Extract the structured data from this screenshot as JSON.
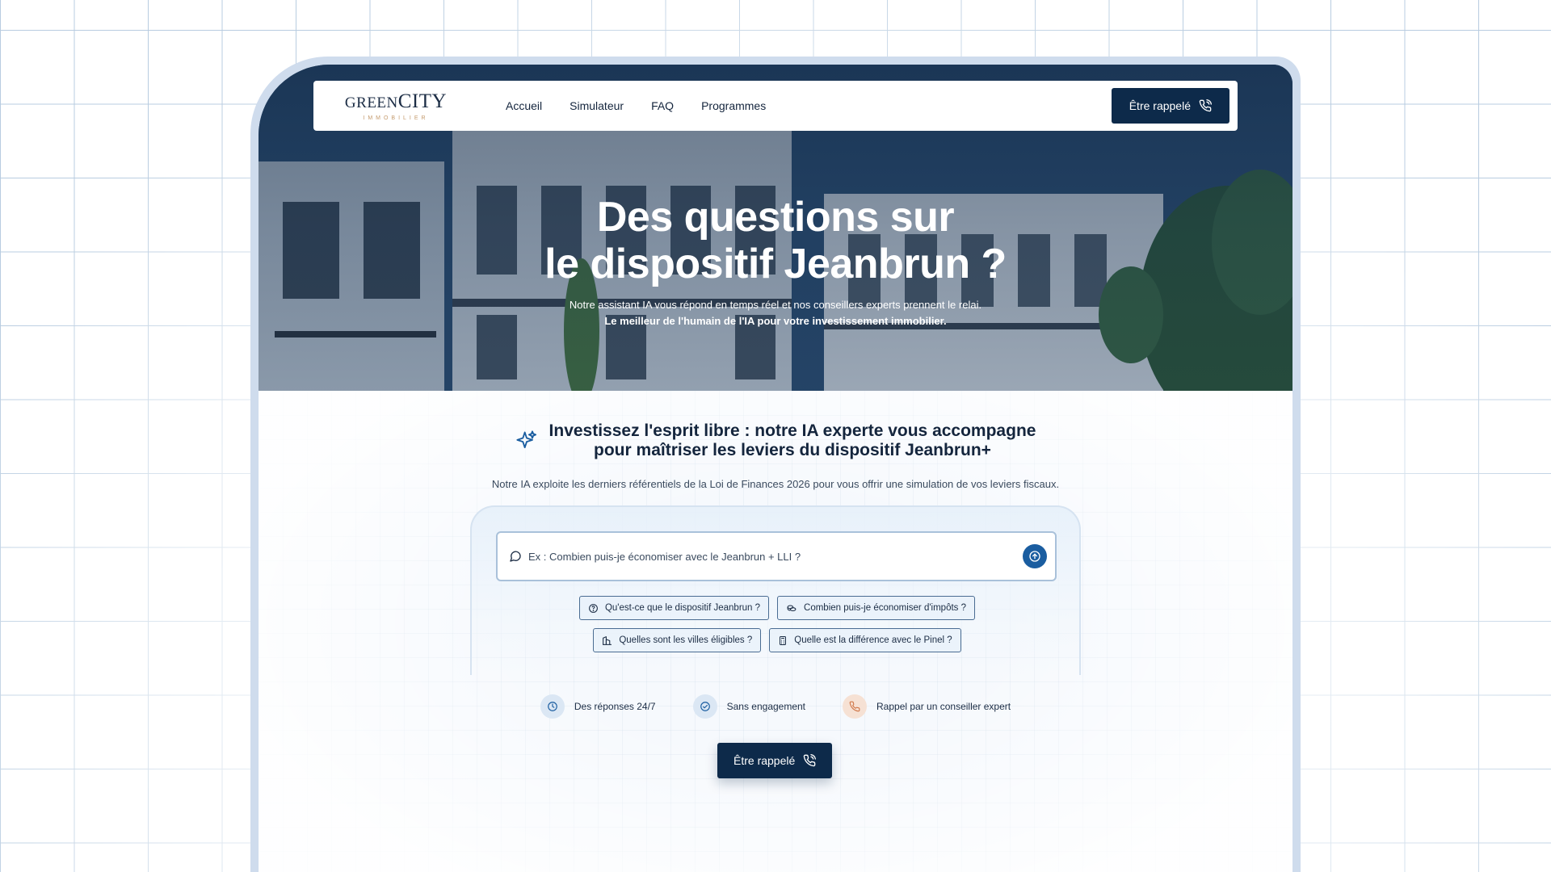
{
  "brand": {
    "name_green": "GREEN",
    "name_city": "CITY",
    "tagline": "IMMOBILIER"
  },
  "nav": {
    "links": [
      "Accueil",
      "Simulateur",
      "FAQ",
      "Programmes"
    ],
    "cta_label": "Être rappelé"
  },
  "hero": {
    "title_line1": "Des questions sur",
    "title_line2": "le dispositif Jeanbrun ?",
    "subtitle": "Notre assistant IA vous répond en temps réel et nos conseillers experts prennent le relai.",
    "subtitle_bold": "Le meilleur de l'humain de l'IA pour votre investissement immobilier."
  },
  "assistant": {
    "title_line1": "Investissez l'esprit libre : notre IA experte vous accompagne",
    "title_line2": "pour maîtriser les leviers du dispositif Jeanbrun+",
    "description": "Notre IA exploite les derniers référentiels de la Loi de Finances 2026 pour vous offrir une simulation de vos leviers fiscaux.",
    "input_placeholder": "Ex : Combien puis-je économiser avec le Jeanbrun + LLI ?",
    "suggestions": [
      {
        "label": "Qu'est-ce que le dispositif Jeanbrun ?",
        "icon": "help-circle-icon"
      },
      {
        "label": "Combien puis-je économiser d'impôts ?",
        "icon": "coins-icon"
      },
      {
        "label": "Quelles sont les villes éligibles ?",
        "icon": "buildings-icon"
      },
      {
        "label": "Quelle est la différence avec le Pinel ?",
        "icon": "calculator-icon"
      }
    ]
  },
  "features": [
    {
      "label": "Des réponses 24/7",
      "icon": "clock-icon"
    },
    {
      "label": "Sans engagement",
      "icon": "check-circle-icon"
    },
    {
      "label": "Rappel par un conseiller expert",
      "icon": "phone-icon"
    }
  ],
  "cta_bottom": {
    "label": "Être rappelé"
  },
  "colors": {
    "primary": "#0d2a4a",
    "accent": "#1a5da0",
    "logo_gold": "#c49a6c",
    "text": "#14253d"
  }
}
